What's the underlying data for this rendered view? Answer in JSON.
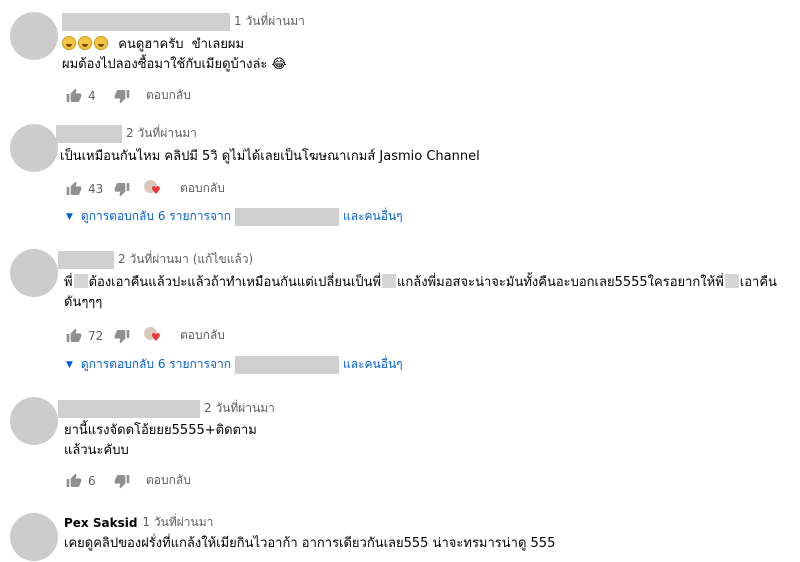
{
  "comments": [
    {
      "author": "",
      "time": "1 วันที่ผ่านมา",
      "lines": [
        "😆😆😆  คนดูฮาครับ  ขำเลยผม",
        "ผมต้องไปลองซื้อมาใช้กับเมียดูบ้างล่ะ 😂"
      ],
      "likes": "4",
      "reply_label": "ตอบกลับ",
      "hearted": false
    },
    {
      "author": "",
      "time": "2 วันที่ผ่านมา",
      "lines": [
        "เป็นเหมือนกันไหม คลิปมี 5วิ ดูไม่ได้เลยเป็นโฆษณาเกมส์ Jasmio Channel"
      ],
      "likes": "43",
      "reply_label": "ตอบกลับ",
      "hearted": true,
      "replies": {
        "prefix": "ดูการตอบกลับ 6 รายการจาก",
        "suffix": "และคนอื่นๆ"
      }
    },
    {
      "author": "",
      "time": "2 วันที่ผ่านมา (แก้ไขแล้ว)",
      "line1_a": "พี่",
      "line1_b": "ต้องเอาคืนแล้วปะแล้วถ้าทำเหมือนกันแต่เปลี่ยนเป็นพี่",
      "line1_c": "แกล้งพี่มอสจะน่าจะมันทั้งคืนอะบอกเลย5555ใครอยากให้พี่",
      "line1_d": "เอาคืน",
      "line2": "ดันๆๆๆ",
      "likes": "72",
      "reply_label": "ตอบกลับ",
      "hearted": true,
      "replies": {
        "prefix": "ดูการตอบกลับ 6 รายการจาก",
        "suffix": "และคนอื่นๆ"
      }
    },
    {
      "author": "",
      "time": "2 วันที่ผ่านมา",
      "lines": [
        "ยานี้แรงจัดดโอ้ยยย5555+ติดตาม",
        "แล้วนะคับบ"
      ],
      "likes": "6",
      "reply_label": "ตอบกลับ",
      "hearted": false
    },
    {
      "author": "Pex Saksid",
      "time": "1 วันที่ผ่านมา",
      "lines": [
        "เคยดูคลิปของฝรั่งที่แกล้งให้เมียกินไวอาก้า อาการเดียวกันเลย555 น่าจะทรมารน่าดู 555"
      ]
    }
  ],
  "icons": {
    "like": "thumb-up-icon",
    "dislike": "thumb-down-icon",
    "heart": "heart-icon",
    "expand": "caret-down-icon"
  },
  "colors": {
    "link": "#065fd4",
    "muted": "#606060",
    "icon": "#909090",
    "heart": "#e53935"
  }
}
